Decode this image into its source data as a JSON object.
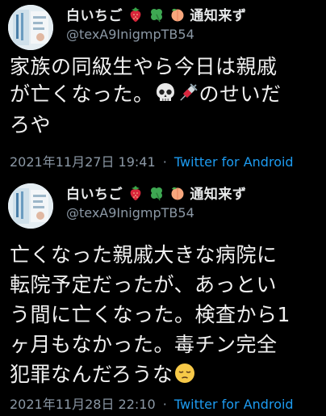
{
  "tweets": [
    {
      "display_name": "白いちご",
      "name_suffix": "通知来ず",
      "handle": "@texA9InigmpTB54",
      "text_part1": "家族の同級生やら今日は親戚\nが亡くなった。",
      "text_part2": "のせいだ\nろや",
      "date": "2021年11月27日 19:41",
      "source": "Twitter for Android"
    },
    {
      "display_name": "白いちご",
      "name_suffix": "通知来ず",
      "handle": "@texA9InigmpTB54",
      "text_part1": "亡くなった親戚大きな病院に\n転院予定だったが、あっとい\nう間に亡くなった。検査から1\nヶ月もなかった。毒チン完全\n犯罪なんだろうな",
      "date": "2021年11月28日 22:10",
      "source": "Twitter for Android"
    }
  ],
  "separator": "·",
  "icons": [
    "strawberry-icon",
    "four-leaf-clover-icon",
    "peach-icon",
    "skull-icon",
    "syringe-icon",
    "pensive-face-icon"
  ]
}
